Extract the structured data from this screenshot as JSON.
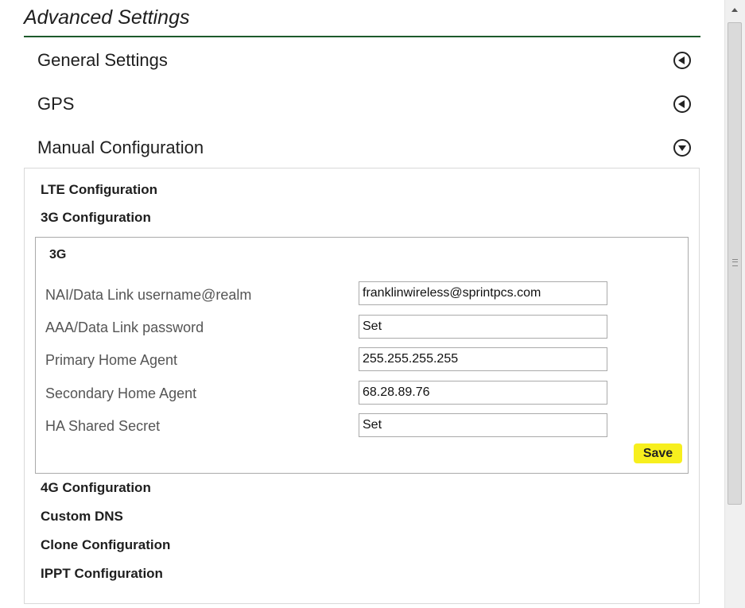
{
  "page": {
    "title": "Advanced Settings"
  },
  "sections": {
    "general": {
      "label": "General Settings",
      "icon": "circle-arrow-left-icon"
    },
    "gps": {
      "label": "GPS",
      "icon": "circle-arrow-left-icon"
    },
    "manual": {
      "label": "Manual Configuration",
      "icon": "circle-arrow-down-icon"
    }
  },
  "manual_config": {
    "lte": "LTE Configuration",
    "threeg": "3G Configuration",
    "fourg": "4G Configuration",
    "custom_dns": "Custom DNS",
    "clone": "Clone Configuration",
    "ippt": "IPPT Configuration"
  },
  "threeg_box": {
    "title": "3G",
    "fields": [
      {
        "label": "NAI/Data Link username@realm",
        "value": "franklinwireless@sprintpcs.com"
      },
      {
        "label": "AAA/Data Link password",
        "value": "Set"
      },
      {
        "label": "Primary Home Agent",
        "value": "255.255.255.255"
      },
      {
        "label": "Secondary Home Agent",
        "value": "68.28.89.76"
      },
      {
        "label": "HA Shared Secret",
        "value": "Set"
      }
    ],
    "save_label": "Save"
  },
  "colors": {
    "title_rule": "#1d5a2b",
    "save_button": "#f7ef1e"
  }
}
